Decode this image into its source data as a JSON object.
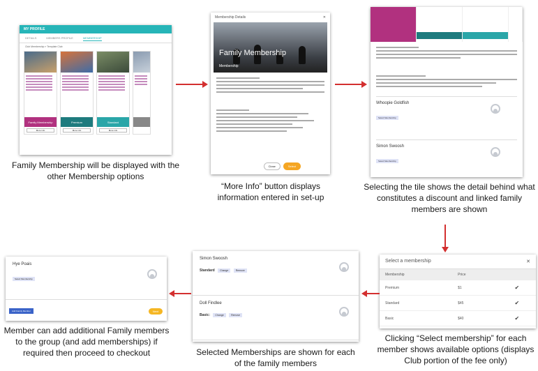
{
  "captions": {
    "c1": "Family Membership will be displayed with the other Membership options",
    "c2": "“More Info” button displays information entered in set-up",
    "c3": "Selecting the tile shows the detail behind what constitutes a discount and linked family members are shown",
    "c4": "Clicking “Select membership” for each member shows available options (displays Club portion of the fee only)",
    "c5": "Selected Memberships are shown for each of the family members",
    "c6": "Member can add additional Family members to the group (and add memberships) if required then proceed to checkout"
  },
  "shot1": {
    "header": "MY PROFILE",
    "tabs": [
      "DETAILS",
      "MEMBERS PROFILE",
      "MEMBERSHIP"
    ],
    "club_line": "Club Membership » Template Club",
    "tiles": [
      {
        "name": "Family Membership",
        "color": "#b1317f",
        "more": "More info"
      },
      {
        "name": "Premium",
        "color": "#1e7b7e",
        "more": "More info"
      },
      {
        "name": "Standard",
        "color": "#2aa6a8",
        "more": "More info"
      }
    ]
  },
  "shot2": {
    "header": "Membership Details",
    "hero_title": "Family Membership",
    "hero_sub": "Membership",
    "close_btn": "Close",
    "select_btn": "Select"
  },
  "shot3": {
    "members": [
      {
        "name": "Whoopie Goldfish",
        "button": "Select Membership"
      },
      {
        "name": "Simon Swoosh",
        "button": "Select Membership"
      }
    ]
  },
  "shot4": {
    "header": "Select a membership",
    "col_membership": "Membership",
    "col_price": "Price",
    "rows": [
      {
        "name": "Premium",
        "price": "$1"
      },
      {
        "name": "Standard",
        "price": "$45"
      },
      {
        "name": "Basic",
        "price": "$40"
      }
    ]
  },
  "shot5": {
    "members": [
      {
        "name": "Simon Swoosh",
        "level": "Standard",
        "chip1": "Change",
        "chip2": "Remove"
      },
      {
        "name": "Doll Findlee",
        "level": "Basic:",
        "chip1": "Change",
        "chip2": "Remove"
      }
    ]
  },
  "shot6": {
    "name": "Hye Poais",
    "button": "Select Membership",
    "add": "Add Family Member",
    "next": "Next"
  },
  "colors": {
    "arrow": "#d32f2f",
    "teal": "#26b5b8",
    "magenta": "#b1317f"
  }
}
